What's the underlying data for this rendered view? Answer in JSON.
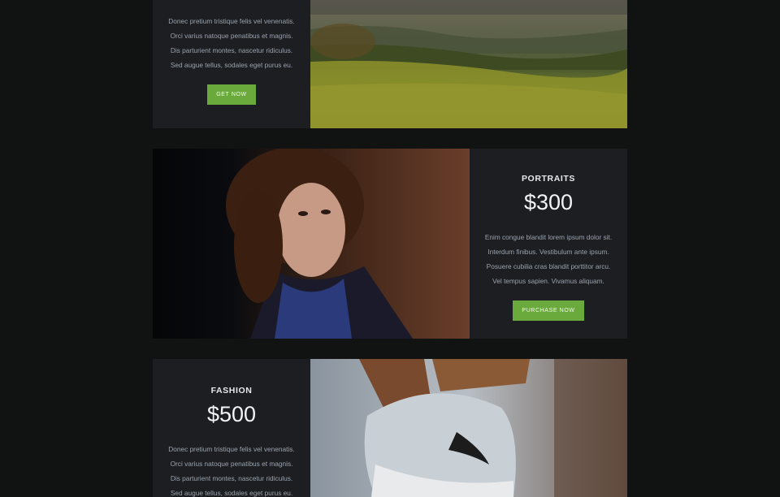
{
  "cards": [
    {
      "title": "",
      "price": "",
      "lines": [
        "Donec pretium tristique felis vel venenatis.",
        "Orci varius natoque penatibus et magnis.",
        "Dis parturient montes, nascetur ridiculus.",
        "Sed augue tellus, sodales eget purus eu."
      ],
      "button": "GET NOW"
    },
    {
      "title": "PORTRAITS",
      "price": "$300",
      "lines": [
        "Enim congue blandit lorem ipsum dolor sit.",
        "Interdum finibus. Vestibulum ante ipsum.",
        "Posuere cubilia cras blandit porttitor arcu.",
        "Vel tempus sapien. Vivamus aliquam."
      ],
      "button": "PURCHASE NOW"
    },
    {
      "title": "FASHION",
      "price": "$500",
      "lines": [
        "Donec pretium tristique felis vel venenatis.",
        "Orci varius natoque penatibus et magnis.",
        "Dis parturient montes, nascetur ridiculus.",
        "Sed augue tellus, sodales eget purus eu."
      ],
      "button": ""
    }
  ],
  "colors": {
    "page_background": "#111212",
    "card_background": "#1c1e22",
    "button_green": "#6aaa3c"
  },
  "photos": [
    "landscape-photo",
    "portrait-photo",
    "sneaker-photo"
  ]
}
